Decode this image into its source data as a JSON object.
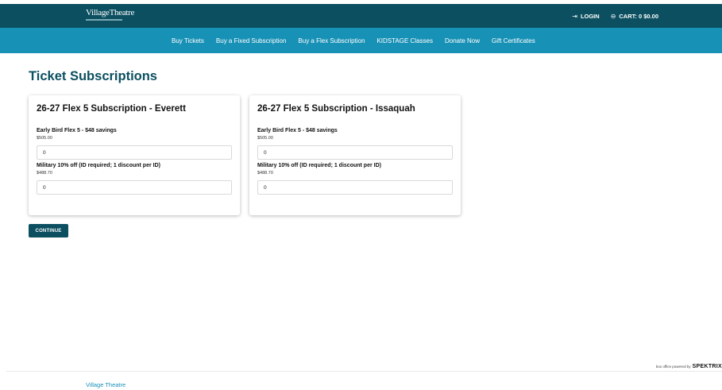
{
  "header": {
    "logo_text": "VillageTheatre",
    "login_label": "LOGIN",
    "cart_label": "CART: 0 $0.00",
    "login_icon": "login-arrow-icon",
    "cart_icon": "cart-icon"
  },
  "nav": {
    "items": [
      {
        "label": "Buy Tickets"
      },
      {
        "label": "Buy a Fixed Subscription"
      },
      {
        "label": "Buy a Flex Subscription"
      },
      {
        "label": "KIDSTAGE Classes"
      },
      {
        "label": "Donate Now"
      },
      {
        "label": "Gift Certificates"
      }
    ]
  },
  "page": {
    "title": "Ticket Subscriptions",
    "continue_label": "CONTINUE"
  },
  "cards": [
    {
      "title": "26-27 Flex 5 Subscription - Everett",
      "tiers": [
        {
          "name": "Early Bird Flex 5 - $48 savings",
          "price": "$505.00",
          "qty": "0"
        },
        {
          "name": "Military 10% off (ID required; 1 discount per ID)",
          "price": "$488.70",
          "qty": "0"
        }
      ]
    },
    {
      "title": "26-27 Flex 5 Subscription - Issaquah",
      "tiers": [
        {
          "name": "Early Bird Flex 5 - $48 savings",
          "price": "$505.00",
          "qty": "0"
        },
        {
          "name": "Military 10% off (ID required; 1 discount per ID)",
          "price": "$488.70",
          "qty": "0"
        }
      ]
    }
  ],
  "footer": {
    "powered_prefix": "box office powered by",
    "powered_brand": "SPEKTRIX",
    "link_label": "Village Theatre"
  },
  "colors": {
    "top_bar": "#0b4f60",
    "nav_bar": "#1891b6",
    "title": "#0b4f60",
    "footer_link": "#1891b6"
  }
}
